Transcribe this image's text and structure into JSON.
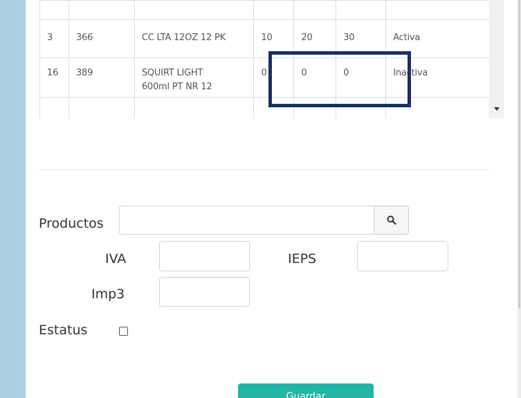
{
  "table": {
    "rows": [
      {
        "id": "",
        "code": "",
        "product": "",
        "v1": "",
        "v2": "",
        "v3": "",
        "status": ""
      },
      {
        "id": "3",
        "code": "366",
        "product": "CC LTA 12OZ 12 PK",
        "v1": "10",
        "v2": "20",
        "v3": "30",
        "status": "Activa"
      },
      {
        "id": "16",
        "code": "389",
        "product_line1": "SQUIRT LIGHT",
        "product_line2": "600ml PT NR 12",
        "v1": "0",
        "v2": "0",
        "v3": "0",
        "status": "Inactiva"
      },
      {
        "id": "",
        "code": "",
        "product": "",
        "v1": "",
        "v2": "",
        "v3": "",
        "status": ""
      }
    ]
  },
  "form": {
    "productos_label": "Productos",
    "productos_value": "",
    "iva_label": "IVA",
    "iva_value": "",
    "ieps_label": "IEPS",
    "ieps_value": "",
    "imp3_label": "Imp3",
    "imp3_value": "",
    "estatus_label": "Estatus",
    "estatus_checked": false,
    "save_label": "Guardar"
  },
  "colors": {
    "highlight_border": "#1a2f62",
    "save_button": "#22b5a3",
    "background": "#a9cde0"
  },
  "icons": {
    "search": "search-icon",
    "scroll_down": "chevron-down-icon"
  }
}
